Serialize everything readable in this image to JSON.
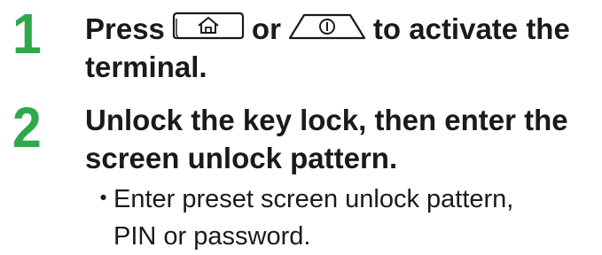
{
  "accent_color": "#2fa84a",
  "steps": [
    {
      "number": "1",
      "title_parts": {
        "before": "Press",
        "key1_icon": "home-key-icon",
        "middle": "or",
        "key2_icon": "power-key-icon",
        "after": "to activate the",
        "line2": "terminal."
      }
    },
    {
      "number": "2",
      "title_line1": "Unlock the key lock, then enter the",
      "title_line2": "screen unlock pattern.",
      "bullet_mark": "・",
      "bullet_line1": "Enter preset screen unlock pattern,",
      "bullet_line2": "PIN or password."
    }
  ]
}
